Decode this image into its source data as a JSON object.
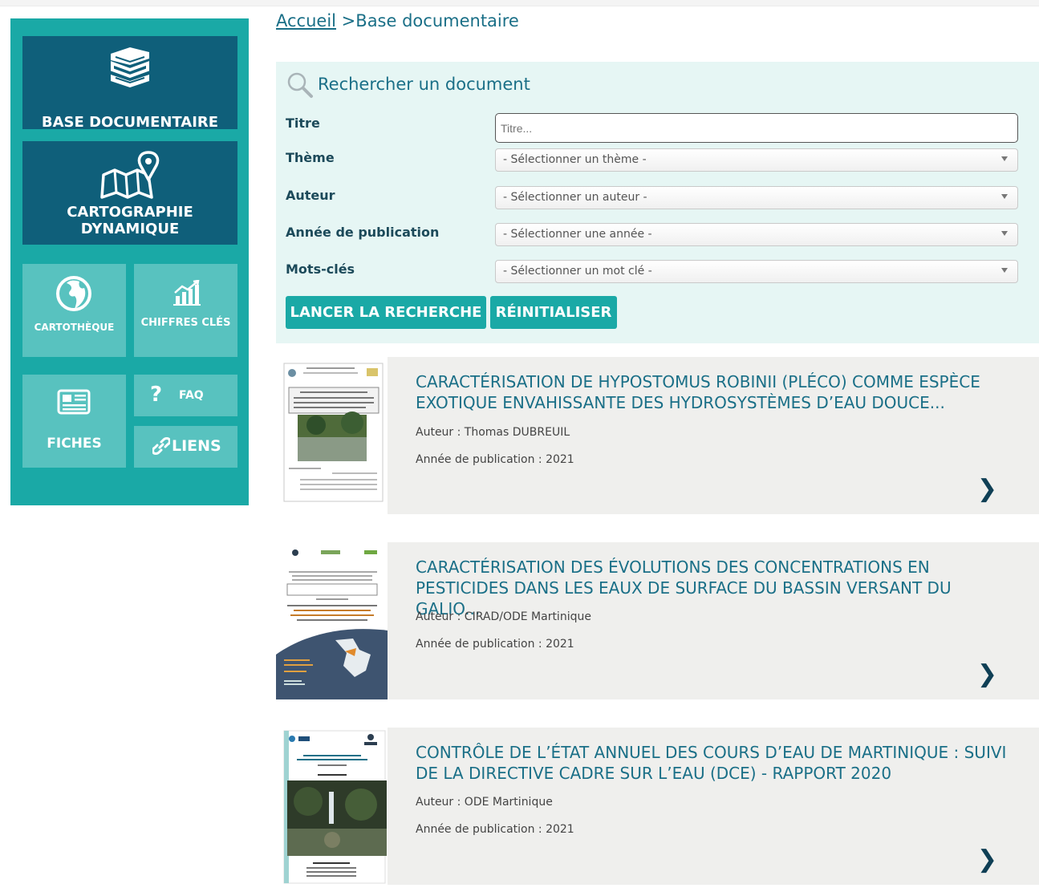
{
  "sidebar": {
    "base": {
      "label": "BASE DOCUMENTAIRE",
      "icon": "books-icon"
    },
    "carto": {
      "label_line1": "CARTOGRAPHIE",
      "label_line2": "DYNAMIQUE",
      "icon": "map-pin-icon"
    },
    "cartotheque": {
      "label": "CARTOTHÈQUE",
      "icon": "globe-icon"
    },
    "chiffres": {
      "label": "CHIFFRES CLÉS",
      "icon": "chart-icon"
    },
    "fiches": {
      "label": "FICHES",
      "icon": "newspaper-icon"
    },
    "faq": {
      "symbol": "?",
      "label": "FAQ"
    },
    "liens": {
      "label": "LIENS",
      "icon": "link-icon"
    }
  },
  "breadcrumb": {
    "home": "Accueil",
    "separator": " >",
    "current": "Base documentaire"
  },
  "search": {
    "title": "Rechercher un document",
    "fields": {
      "titre": {
        "label": "Titre",
        "placeholder": "Titre..."
      },
      "theme": {
        "label": "Thème",
        "value": "- Sélectionner un thème -"
      },
      "auteur": {
        "label": "Auteur",
        "value": "- Sélectionner un auteur -"
      },
      "annee": {
        "label": "Année de publication",
        "value": "- Sélectionner une année -"
      },
      "motscles": {
        "label": "Mots-clés",
        "value": "- Sélectionner un mot clé -"
      }
    },
    "submit_label": "LANCER LA RECHERCHE",
    "reset_label": "RÉINITIALISER"
  },
  "results": [
    {
      "title": "CARACTÉRISATION DE HYPOSTOMUS ROBINII (PLÉCO) COMME ESPÈCE EXOTIQUE ENVAHISSANTE DES HYDROSYSTÈMES D’EAU DOUCE...",
      "author": "Auteur : Thomas DUBREUIL",
      "year": "Année de publication : 2021",
      "arrow": "❯"
    },
    {
      "title": "CARACTÉRISATION DES ÉVOLUTIONS DES CONCENTRATIONS EN PESTICIDES DANS LES EAUX DE SURFACE DU BASSIN VERSANT DU GALIO...",
      "author": "Auteur : CIRAD/ODE Martinique",
      "year": "Année de publication : 2021",
      "arrow": "❯"
    },
    {
      "title": "CONTRÔLE DE L’ÉTAT ANNUEL DES COURS D’EAU DE MARTINIQUE : SUIVI DE LA DIRECTIVE CADRE SUR L’EAU (DCE) - RAPPORT 2020",
      "author": "Auteur : ODE Martinique",
      "year": "Année de publication : 2021",
      "arrow": "❯"
    }
  ],
  "colors": {
    "teal": "#1aa9a6",
    "dark_blue": "#0f5f7a",
    "light_teal": "#58c2bf",
    "panel_bg": "#e6f6f4",
    "title_blue": "#1a6f87"
  }
}
